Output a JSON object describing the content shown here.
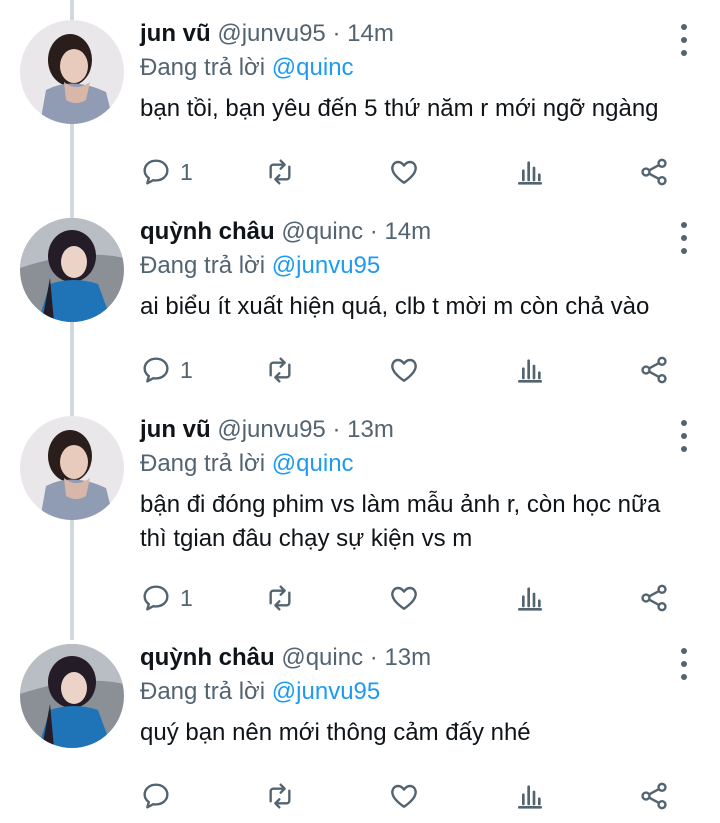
{
  "reply_prefix": "Đang trả lời",
  "tweets": [
    {
      "name": "jun vũ",
      "handle": "@junvu95",
      "separator": "·",
      "time": "14m",
      "reply_to": "@quinc",
      "text": "bạn tồi, bạn yêu đến 5 thứ năm r mới ngỡ ngàng",
      "reply_count": "1",
      "avatar": "avatar-jun"
    },
    {
      "name": "quỳnh châu",
      "handle": "@quinc",
      "separator": "·",
      "time": "14m",
      "reply_to": "@junvu95",
      "text": "ai biểu ít xuất hiện quá, clb t mời m còn chả vào",
      "reply_count": "1",
      "avatar": "avatar-quynh"
    },
    {
      "name": "jun vũ",
      "handle": "@junvu95",
      "separator": "·",
      "time": "13m",
      "reply_to": "@quinc",
      "text": "bận đi đóng phim vs làm mẫu ảnh r, còn học nữa thì tgian đâu chạy sự kiện vs m",
      "reply_count": "1",
      "avatar": "avatar-jun"
    },
    {
      "name": "quỳnh châu",
      "handle": "@quinc",
      "separator": "·",
      "time": "13m",
      "reply_to": "@junvu95",
      "text": "quý bạn nên mới thông cảm đấy nhé",
      "reply_count": "",
      "avatar": "avatar-quynh"
    }
  ],
  "icons": {
    "reply": "reply-icon",
    "retweet": "retweet-icon",
    "like": "heart-icon",
    "views": "views-icon",
    "share": "share-icon",
    "more": "more-icon"
  },
  "colors": {
    "link": "#1d9bf0",
    "secondary": "#536471",
    "thread_line": "#cfd9de"
  }
}
